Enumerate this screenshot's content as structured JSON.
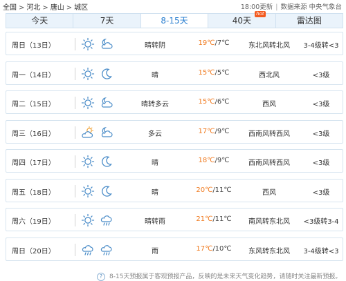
{
  "breadcrumb": [
    "全国",
    "河北",
    "唐山",
    "城区"
  ],
  "source": {
    "time": "18:00更新",
    "label": "数据来源 中央气象台"
  },
  "tabs": [
    {
      "label": "今天",
      "active": false
    },
    {
      "label": "7天",
      "active": false
    },
    {
      "label": "8-15天",
      "active": true
    },
    {
      "label": "40天",
      "active": false,
      "badge": "hot"
    },
    {
      "label": "雷达图",
      "active": false
    }
  ],
  "forecast": [
    {
      "day": "周日（13日）",
      "icons": [
        "sun-icon",
        "cloudy-moon-icon"
      ],
      "condition": "晴转阴",
      "high": "19℃",
      "low": "/7℃",
      "wind": "东北风转北风",
      "level": "3-4级转<3"
    },
    {
      "day": "周一（14日）",
      "icons": [
        "sun-icon",
        "moon-icon"
      ],
      "condition": "晴",
      "high": "15℃",
      "low": "/5℃",
      "wind": "西北风",
      "level": "<3级"
    },
    {
      "day": "周二（15日）",
      "icons": [
        "sun-icon",
        "cloudy-moon-icon"
      ],
      "condition": "晴转多云",
      "high": "15℃",
      "low": "/6℃",
      "wind": "西风",
      "level": "<3级"
    },
    {
      "day": "周三（16日）",
      "icons": [
        "partly-cloudy-icon",
        "cloudy-moon-icon"
      ],
      "condition": "多云",
      "high": "17℃",
      "low": "/9℃",
      "wind": "西南风转西风",
      "level": "<3级"
    },
    {
      "day": "周四（17日）",
      "icons": [
        "sun-icon",
        "moon-icon"
      ],
      "condition": "晴",
      "high": "18℃",
      "low": "/9℃",
      "wind": "西南风转西风",
      "level": "<3级"
    },
    {
      "day": "周五（18日）",
      "icons": [
        "sun-icon",
        "moon-icon"
      ],
      "condition": "晴",
      "high": "20℃",
      "low": "/11℃",
      "wind": "西风",
      "level": "<3级"
    },
    {
      "day": "周六（19日）",
      "icons": [
        "sun-icon",
        "rain-cloud-icon"
      ],
      "condition": "晴转雨",
      "high": "21℃",
      "low": "/11℃",
      "wind": "南风转东北风",
      "level": "<3级转3-4"
    },
    {
      "day": "周日（20日）",
      "icons": [
        "rain-cloud-icon",
        "rain-cloud-icon"
      ],
      "condition": "雨",
      "high": "17℃",
      "low": "/10℃",
      "wind": "东风转东北风",
      "level": "3-4级转<3"
    }
  ],
  "note": "8-15天预报属于客观预报产品，反映的是未来天气变化趋势，请随时关注最新预报。",
  "colors": {
    "accent": "#2a7fd0",
    "temp_high": "#f07a1f",
    "icon": "#4a8cc8"
  }
}
